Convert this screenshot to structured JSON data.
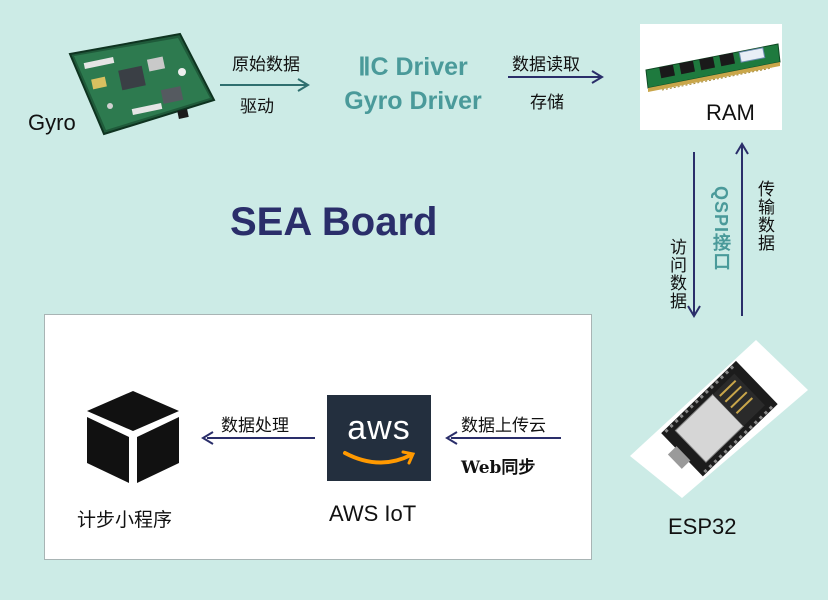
{
  "diagram": {
    "title": "SEA Board",
    "nodes": {
      "gyro": "Gyro",
      "ram": "RAM",
      "esp32": "ESP32",
      "aws": "AWS IoT",
      "app": "计步小程序",
      "aws_logo_text": "aws"
    },
    "driver_label": {
      "line1": "ⅡC Driver",
      "line2": "Gyro Driver"
    },
    "edges": {
      "gyro_to_driver": {
        "top": "原始数据",
        "bottom": "驱动"
      },
      "driver_to_ram": {
        "top": "数据读取",
        "bottom": "存储"
      },
      "ram_esp_interface": "QSPI接口",
      "ram_to_esp": "访问数据",
      "esp_to_ram": "传输数据",
      "esp_to_aws": {
        "top": "数据上传云",
        "bottom": "Web同步"
      },
      "aws_to_app": "数据处理"
    },
    "colors": {
      "background": "#ccebe6",
      "arrow_navy": "#2a2e6a",
      "arrow_teal": "#2f6f6f",
      "title": "#2a2e6a",
      "accent_teal": "#4a9a9a"
    }
  }
}
